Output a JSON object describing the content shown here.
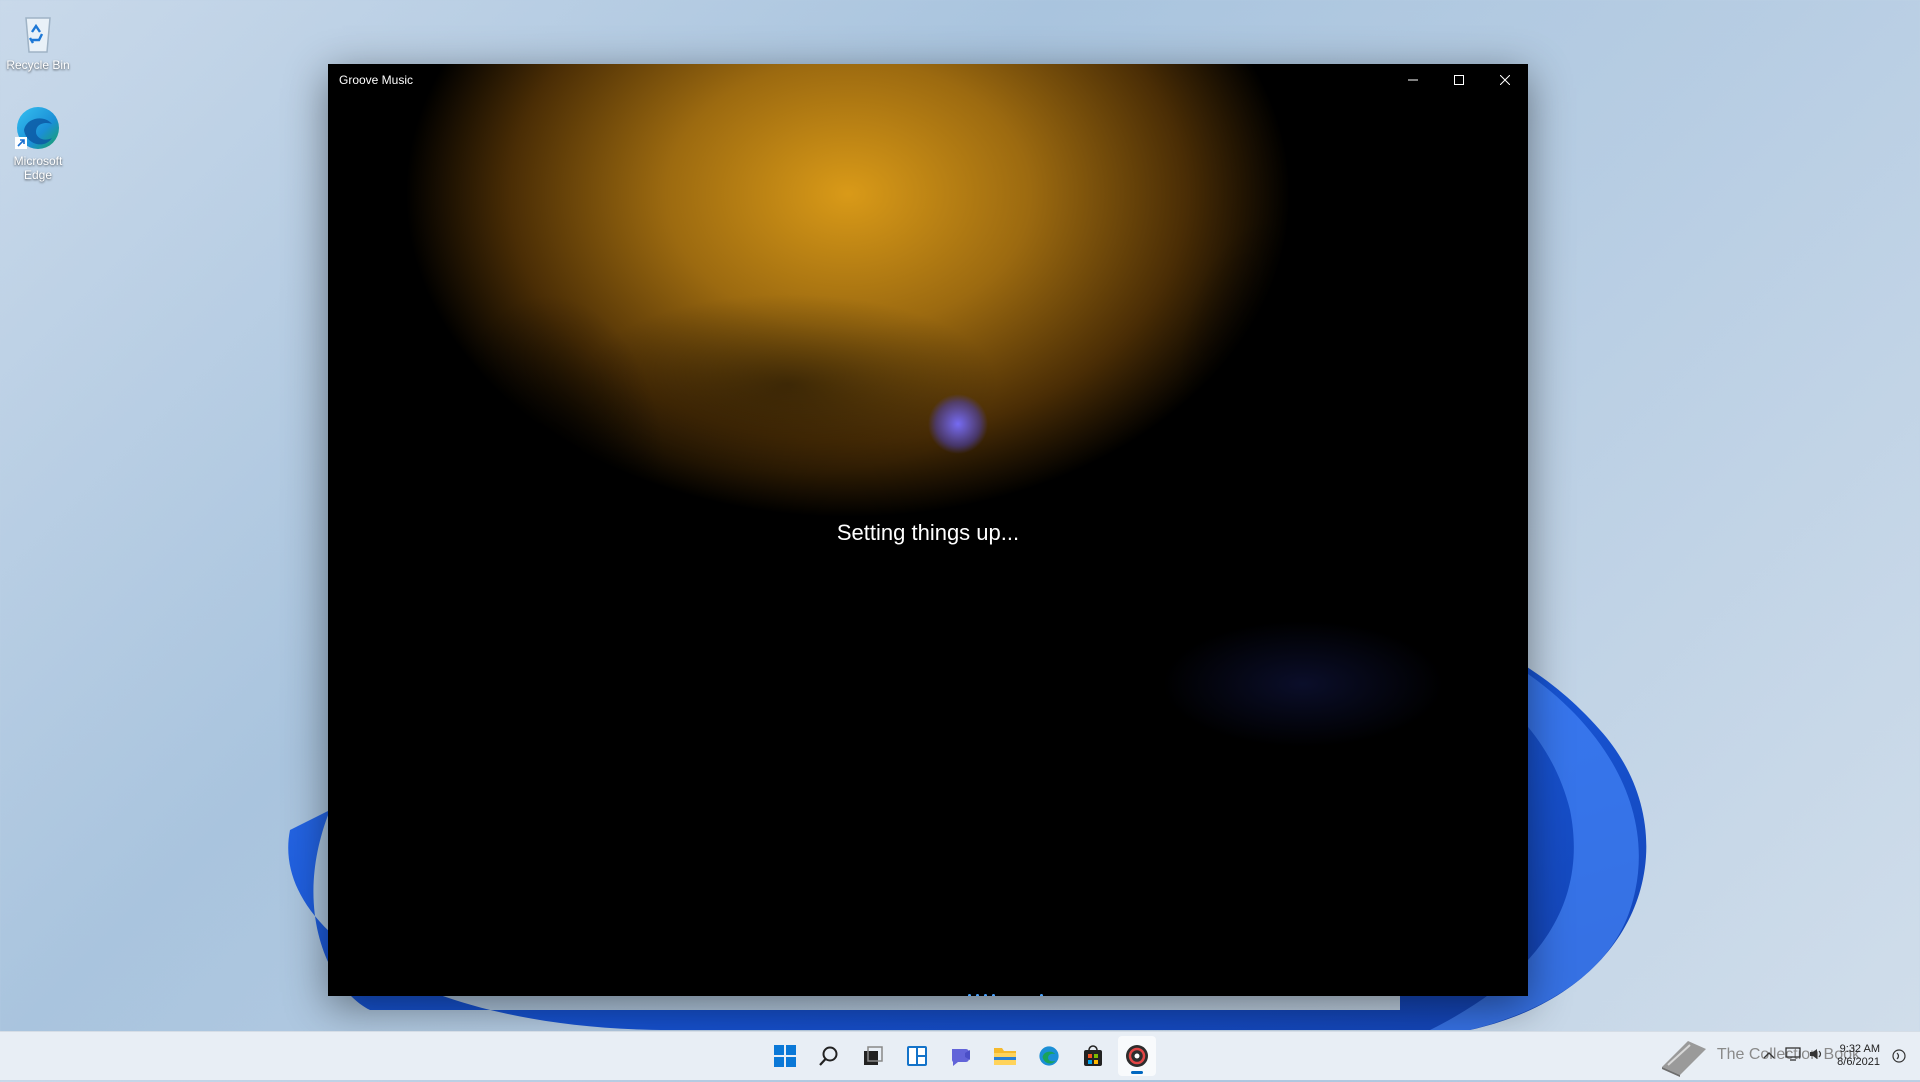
{
  "desktop": {
    "icons": [
      {
        "label": "Recycle Bin",
        "icon": "recycle-bin-icon"
      },
      {
        "label": "Microsoft Edge",
        "icon": "edge-icon"
      }
    ]
  },
  "window": {
    "title": "Groove Music",
    "status_text": "Setting things up...",
    "controls": [
      "minimize-icon",
      "maximize-icon",
      "close-icon"
    ]
  },
  "taskbar": {
    "apps": [
      "start-icon",
      "search-icon",
      "task-view-icon",
      "widgets-icon",
      "chat-icon",
      "file-explorer-icon",
      "edge-icon",
      "store-icon",
      "groove-music-icon"
    ],
    "active_app": "groove-music-icon",
    "clock_time": "9:32 AM",
    "clock_date": "8/6/2021",
    "watermark": "The Collection Book"
  },
  "colors": {
    "accent": "#0067c0",
    "window_bg": "#000000",
    "art_gold": "#d99a18",
    "taskbar_bg": "#e8eef5"
  }
}
